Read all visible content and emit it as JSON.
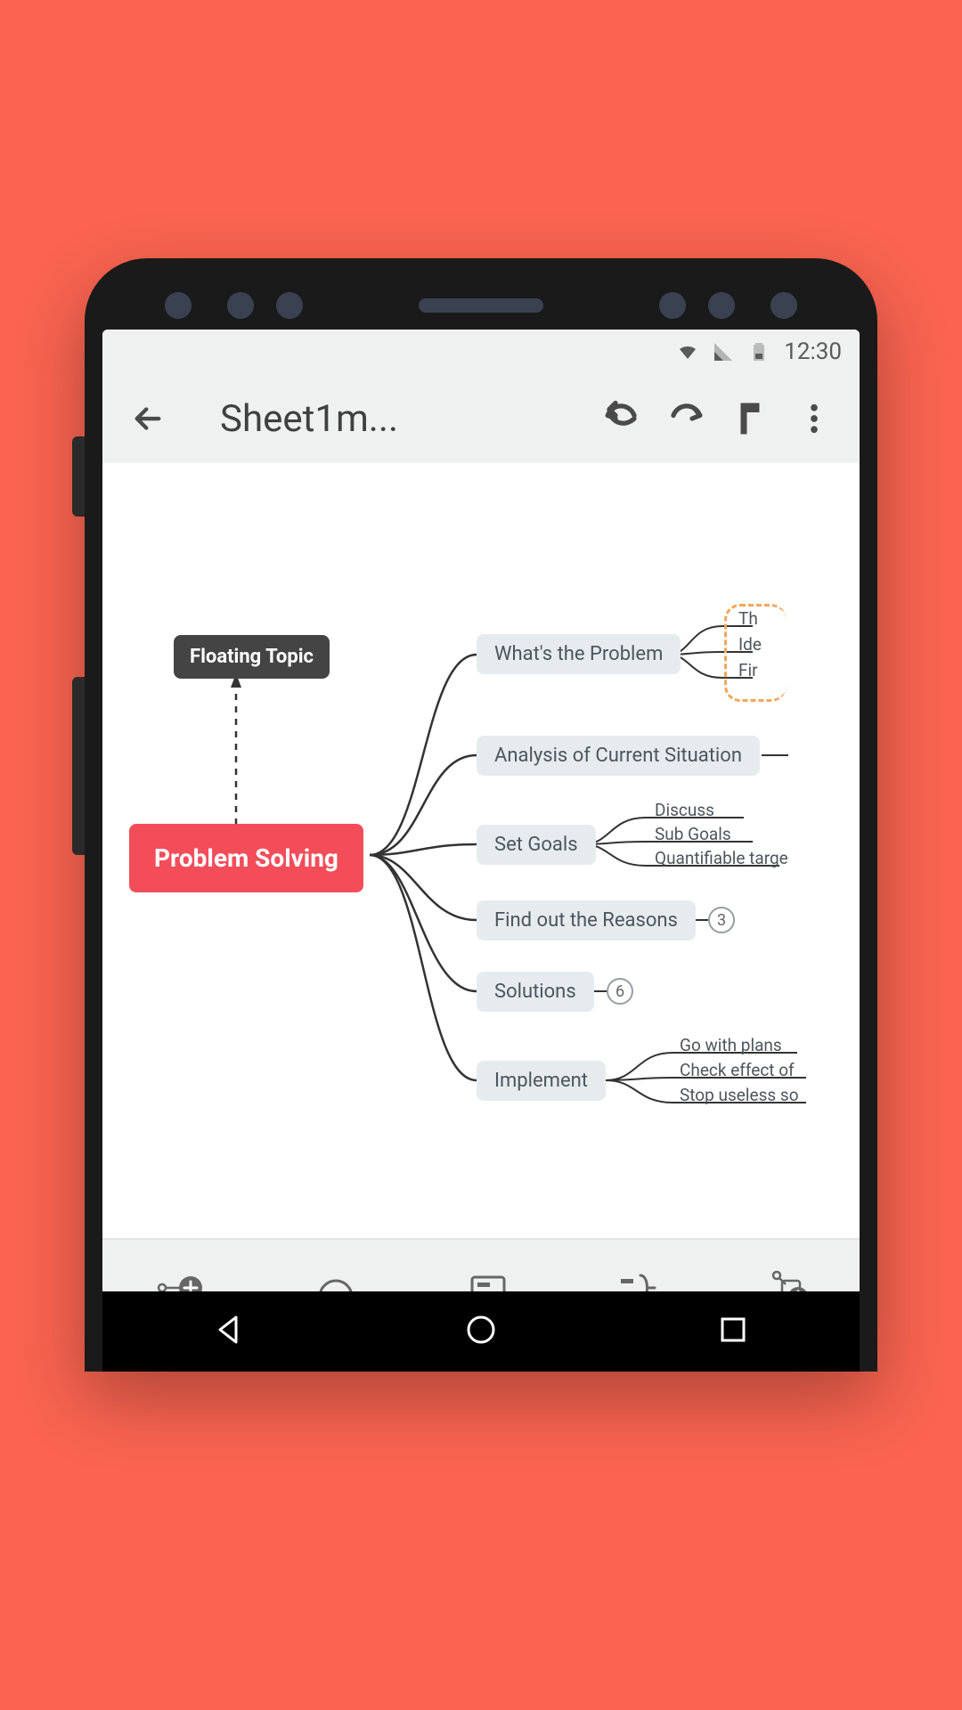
{
  "status": {
    "time": "12:30"
  },
  "header": {
    "title": "Sheet1m..."
  },
  "mindmap": {
    "root": "Problem Solving",
    "floating": "Floating Topic",
    "branches": [
      {
        "label": "What's the Problem",
        "leaves": [
          "Th",
          "Ide",
          "Fir"
        ],
        "highlight": true
      },
      {
        "label": "Analysis of Current Situation",
        "leaves": []
      },
      {
        "label": "Set Goals",
        "leaves": [
          "Discuss",
          "Sub Goals",
          "Quantifiable targe"
        ]
      },
      {
        "label": "Find out the Reasons",
        "badge": "3"
      },
      {
        "label": "Solutions",
        "badge": "6"
      },
      {
        "label": "Implement",
        "leaves": [
          "Go with plans",
          "Check effect of",
          "Stop useless so"
        ]
      }
    ]
  }
}
